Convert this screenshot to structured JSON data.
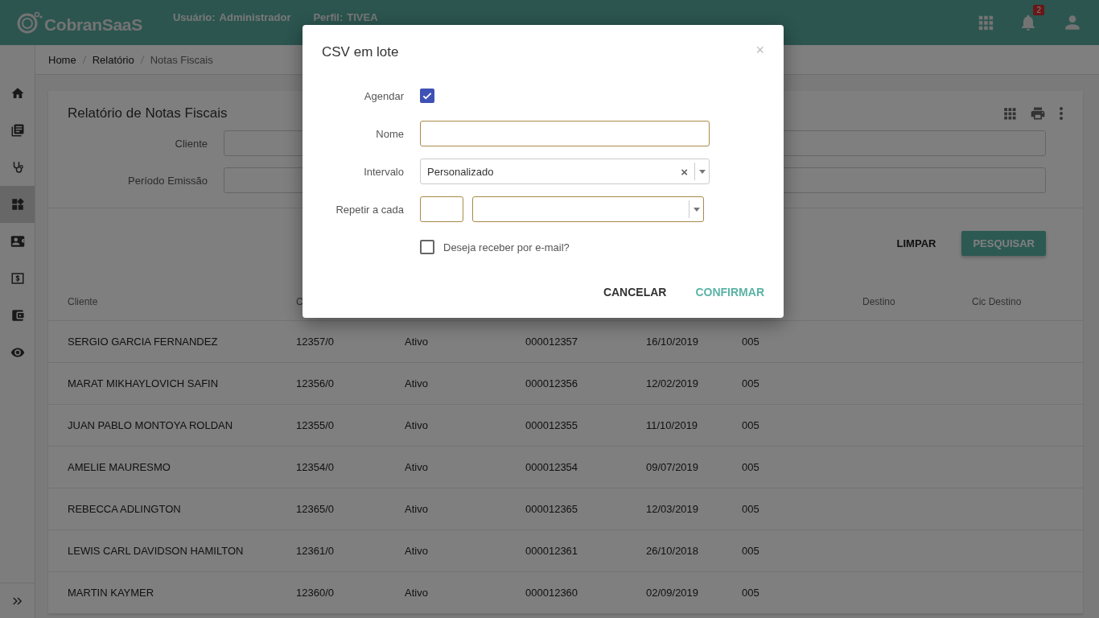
{
  "header": {
    "logo": "CobranSaaS",
    "user_label": "Usuário:",
    "user": "Administrador",
    "profile_label": "Perfil:",
    "profile": "TIVEA",
    "notification_count": "2"
  },
  "sidebar": {
    "items": [
      {
        "kind": "home",
        "selected": false
      },
      {
        "kind": "documents",
        "selected": false
      },
      {
        "kind": "stethoscope",
        "selected": false
      },
      {
        "kind": "widgets",
        "selected": true
      },
      {
        "kind": "contact",
        "selected": false
      },
      {
        "kind": "money",
        "selected": false
      },
      {
        "kind": "wallet",
        "selected": false
      },
      {
        "kind": "eye",
        "selected": false
      }
    ]
  },
  "breadcrumb": [
    "Home",
    "Relatório",
    "Notas Fiscais"
  ],
  "report": {
    "title": "Relatório de Notas Fiscais",
    "filters": [
      {
        "label": "Cliente"
      },
      {
        "label": "Período Emissão"
      }
    ],
    "buttons": [
      {
        "label": "LIMPAR",
        "kind": "flat"
      },
      {
        "label": "PESQUISAR",
        "kind": "raised"
      }
    ]
  },
  "table": {
    "columns": [
      "Cliente",
      "C",
      null,
      null,
      null,
      null,
      "Destino",
      "Cic Destino"
    ],
    "rows": [
      [
        "SERGIO GARCIA FERNANDEZ",
        "12357/0",
        "Ativo",
        "000012357",
        "16/10/2019",
        "005"
      ],
      [
        "MARAT MIKHAYLOVICH SAFIN",
        "12356/0",
        "Ativo",
        "000012356",
        "12/02/2019",
        "005"
      ],
      [
        "JUAN PABLO MONTOYA ROLDAN",
        "12355/0",
        "Ativo",
        "000012355",
        "11/10/2019",
        "005"
      ],
      [
        "AMELIE MAURESMO",
        "12354/0",
        "Ativo",
        "000012354",
        "09/07/2019",
        "005"
      ],
      [
        "REBECCA ADLINGTON",
        "12365/0",
        "Ativo",
        "000012365",
        "12/03/2019",
        "005"
      ],
      [
        "LEWIS CARL DAVIDSON HAMILTON",
        "12361/0",
        "Ativo",
        "000012361",
        "26/10/2018",
        "005"
      ],
      [
        "MARTIN KAYMER",
        "12360/0",
        "Ativo",
        "000012360",
        "02/09/2019",
        "005"
      ]
    ]
  },
  "modal": {
    "title": "CSV em lote",
    "close": "×",
    "fields": [
      {
        "kind": "checkbox",
        "label": "Agendar",
        "checked": true
      },
      {
        "kind": "text",
        "label": "Nome"
      },
      {
        "kind": "select",
        "label": "Intervalo",
        "value": "Personalizado",
        "clear": "×"
      },
      {
        "kind": "repeat",
        "label": "Repetir a cada"
      },
      {
        "kind": "checkbox",
        "text": "Deseja receber por e-mail?",
        "checked": false
      }
    ],
    "buttons": [
      {
        "label": "CANCELAR",
        "kind": "plain"
      },
      {
        "label": "CONFIRMAR",
        "kind": "primary"
      }
    ]
  }
}
